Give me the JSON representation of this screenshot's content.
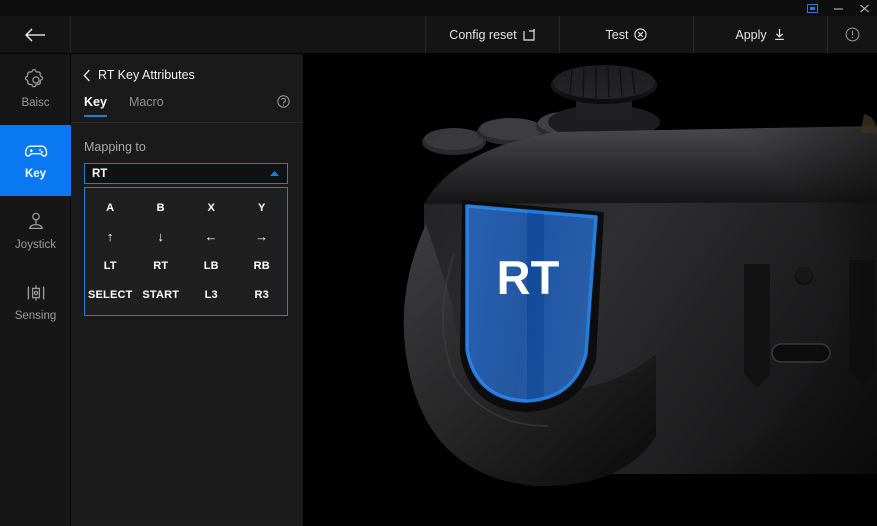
{
  "titlebar": {
    "buttons": [
      {
        "name": "link-icon",
        "label": ""
      },
      {
        "name": "minimize-button",
        "label": ""
      },
      {
        "name": "close-button",
        "label": ""
      }
    ]
  },
  "toolbar": {
    "back_label": "",
    "config_reset_label": "Config reset",
    "test_label": "Test",
    "apply_label": "Apply",
    "info_label": ""
  },
  "sidebar": {
    "items": [
      {
        "label": "Baisc",
        "icon": "gear-icon",
        "active": false
      },
      {
        "label": "Key",
        "icon": "gamepad-icon",
        "active": true
      },
      {
        "label": "Joystick",
        "icon": "joystick-icon",
        "active": false
      },
      {
        "label": "Sensing",
        "icon": "sensor-icon",
        "active": false
      }
    ]
  },
  "panel": {
    "title": "RT Key Attributes",
    "tabs": [
      {
        "label": "Key",
        "active": true
      },
      {
        "label": "Macro",
        "active": false
      }
    ],
    "help_icon": "help-icon",
    "mapping_label": "Mapping to",
    "dropdown": {
      "value": "RT",
      "expanded": true,
      "options": [
        "A",
        "B",
        "X",
        "Y",
        "↑",
        "↓",
        "←",
        "→",
        "LT",
        "RT",
        "LB",
        "RB",
        "SELECT",
        "START",
        "L3",
        "R3"
      ]
    }
  },
  "stage": {
    "highlight_label": "RT",
    "accent_color": "#1f7ce0",
    "highlight_fill": "#1458b8",
    "background": "#000000"
  }
}
